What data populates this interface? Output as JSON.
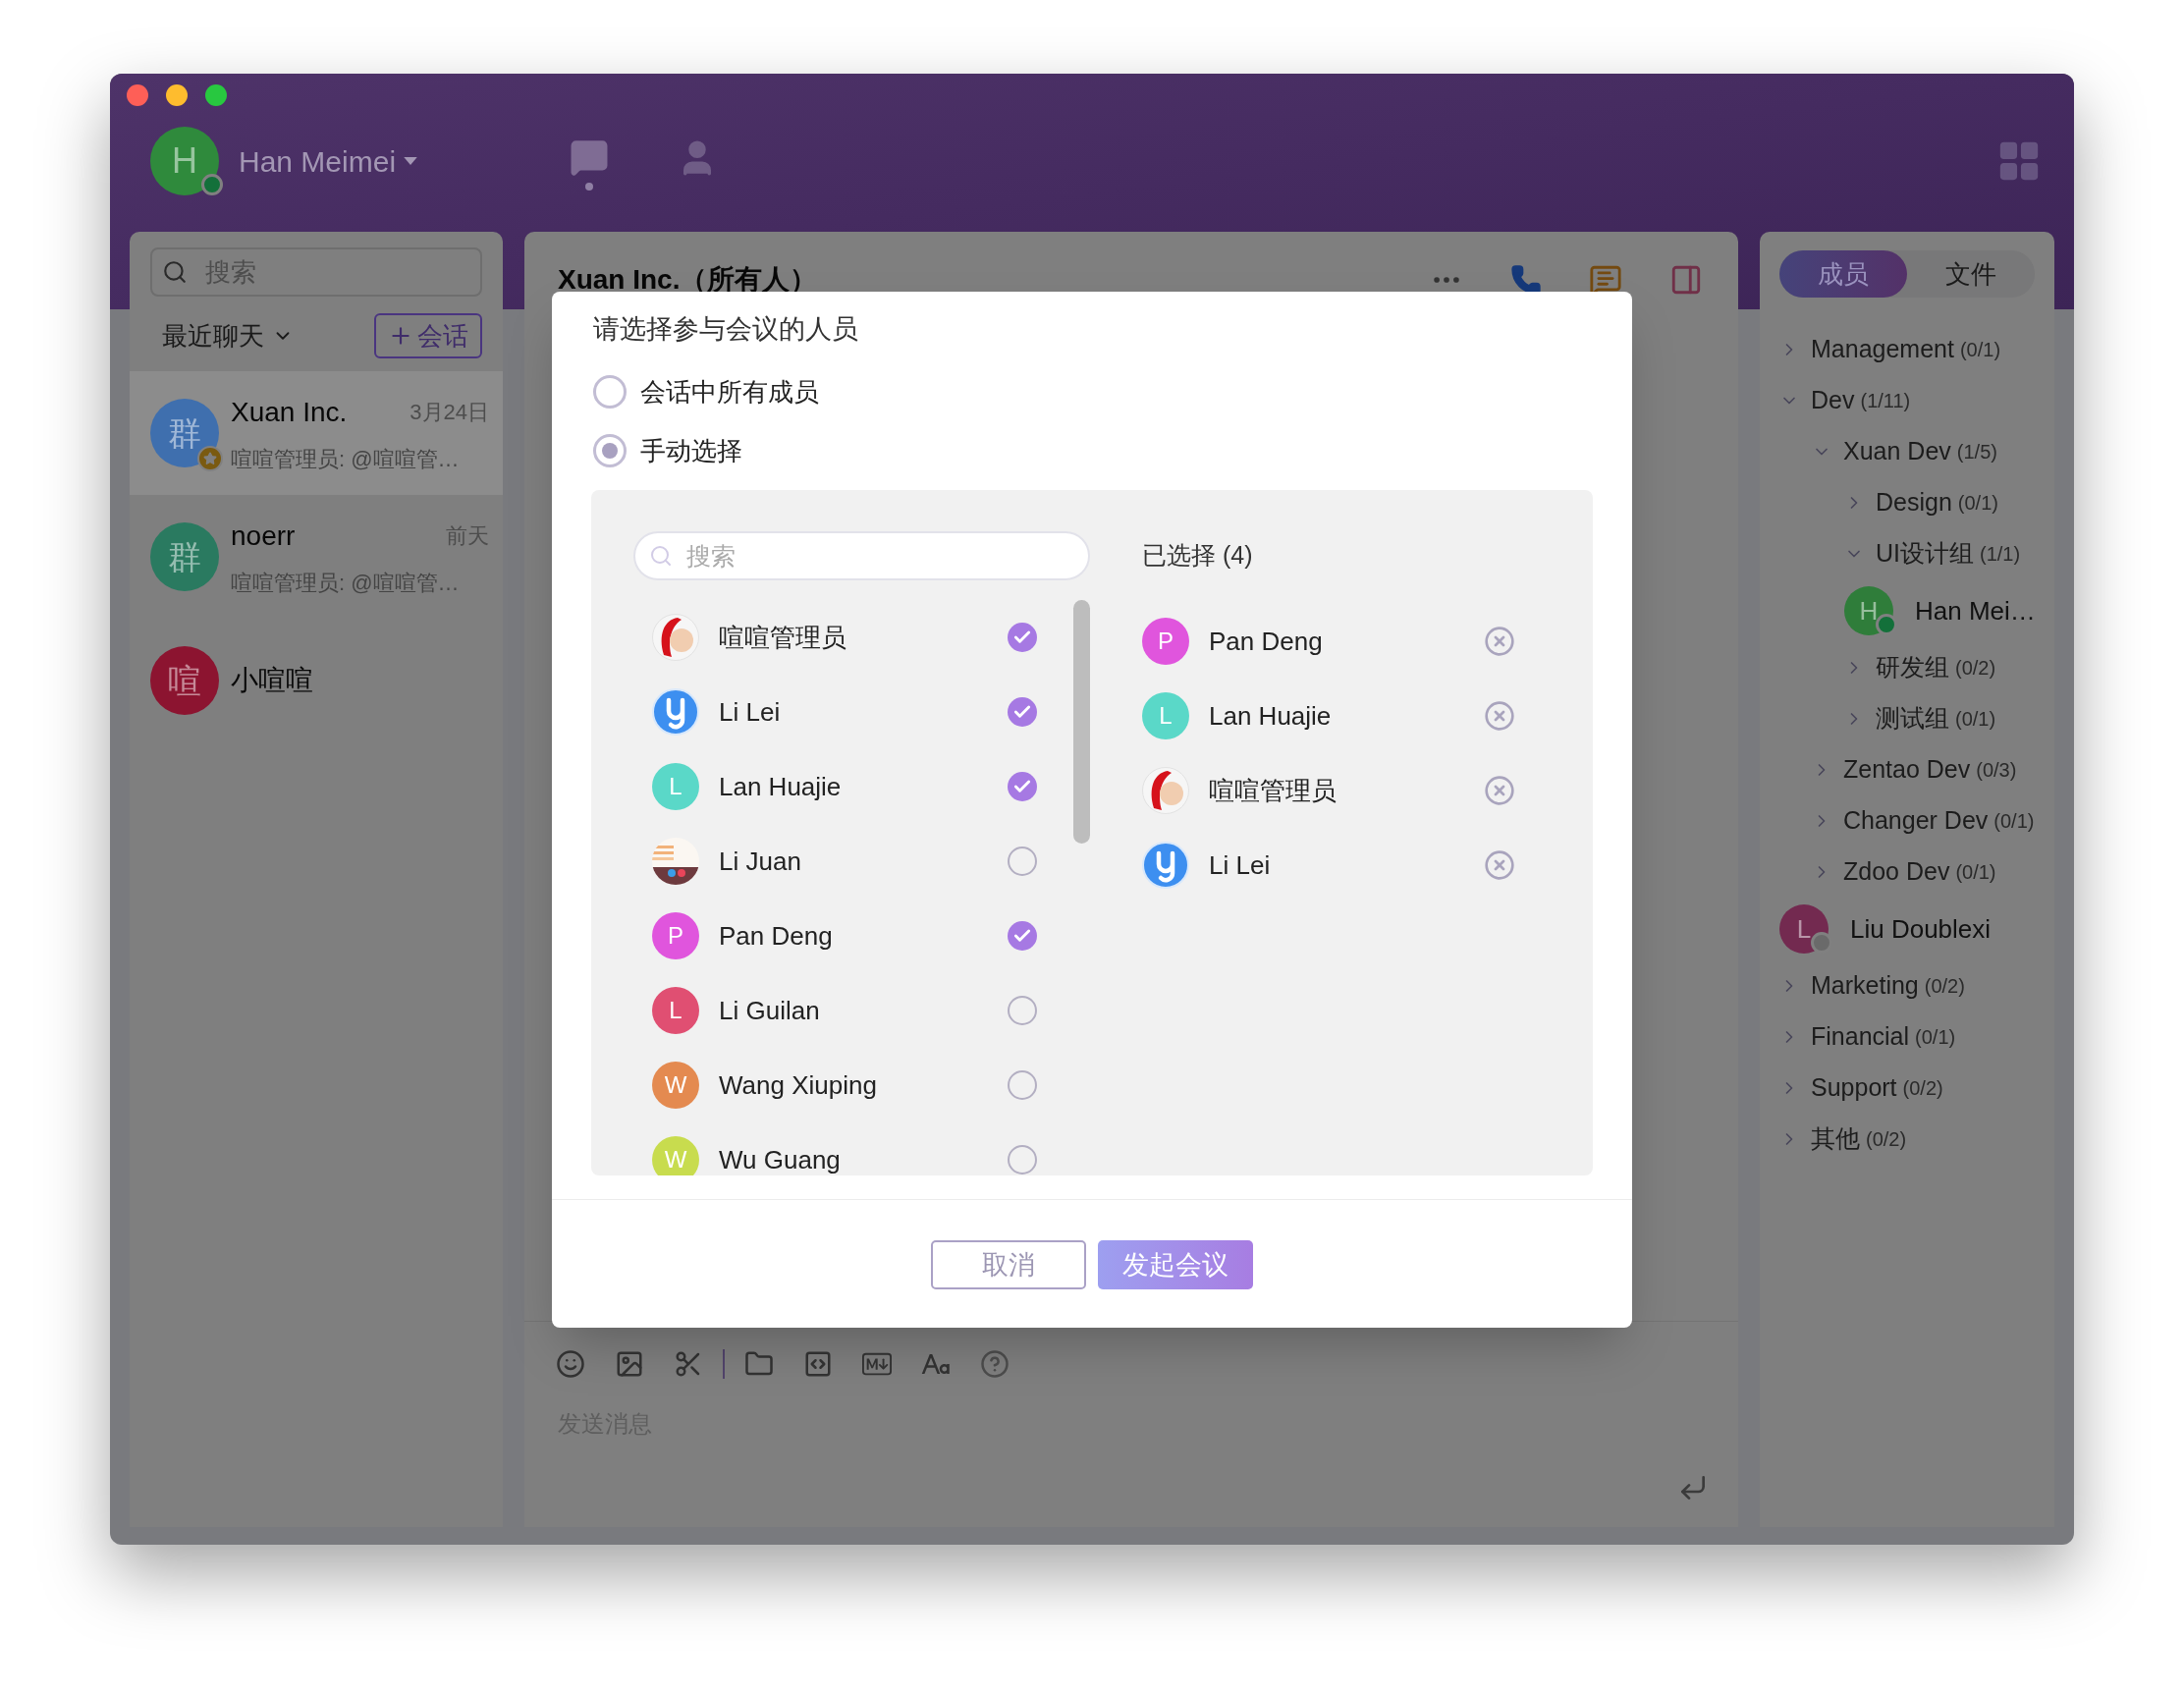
{
  "header": {
    "user": {
      "name": "Han Meimei",
      "avatar": {
        "kind": "letter",
        "initial": "H",
        "color": "#2f8a3c"
      },
      "online": true
    },
    "nav": [
      {
        "kind": "chat",
        "selected": true
      },
      {
        "kind": "contacts",
        "selected": false
      }
    ]
  },
  "sidebar": {
    "search": {
      "placeholder": "搜索"
    },
    "filter": "最近聊天",
    "new_chat_button": "会话",
    "chats": [
      {
        "name": "Xuan Inc.",
        "time": "3月24日",
        "preview": "喧喧管理员: @喧喧管…",
        "avatar": {
          "kind": "letter",
          "initial": "群",
          "color": "#3f6fae"
        },
        "starred": true,
        "selected": true
      },
      {
        "name": "noerr",
        "time": "前天",
        "preview": "喧喧管理员: @喧喧管…",
        "avatar": {
          "kind": "letter",
          "initial": "群",
          "color": "#2a7a60"
        },
        "starred": false,
        "selected": false
      },
      {
        "name": "小喧喧",
        "avatar": {
          "kind": "letter",
          "initial": "喧",
          "color": "#8c1430"
        },
        "starred": false,
        "selected": false
      }
    ]
  },
  "conversation": {
    "title": "Xuan Inc.（所有人）",
    "input_placeholder": "发送消息"
  },
  "members_panel": {
    "tabs": [
      {
        "label": "成员",
        "selected": true
      },
      {
        "label": "文件",
        "selected": false
      }
    ],
    "tree": [
      {
        "kind": "group",
        "label": "Management",
        "count": "(0/1)",
        "expanded": false
      },
      {
        "kind": "group",
        "label": "Dev",
        "count": "(1/11)",
        "expanded": true,
        "children": [
          {
            "kind": "group",
            "label": "Xuan Dev",
            "count": "(1/5)",
            "expanded": true,
            "children": [
              {
                "kind": "group",
                "label": "Design",
                "count": "(0/1)",
                "expanded": false
              },
              {
                "kind": "group",
                "label": "UI设计组",
                "count": "(1/1)",
                "expanded": true,
                "children": [
                  {
                    "kind": "member",
                    "name": "Han Mei…",
                    "avatar": {
                      "kind": "letter",
                      "initial": "H",
                      "color": "#2f7d3a"
                    },
                    "online": true
                  }
                ]
              },
              {
                "kind": "group",
                "label": "研发组",
                "count": "(0/2)",
                "expanded": false
              },
              {
                "kind": "group",
                "label": "测试组",
                "count": "(0/1)",
                "expanded": false
              }
            ]
          },
          {
            "kind": "group",
            "label": "Zentao Dev",
            "count": "(0/3)",
            "expanded": false
          },
          {
            "kind": "group",
            "label": "Changer Dev",
            "count": "(0/1)",
            "expanded": false
          },
          {
            "kind": "group",
            "label": "Zdoo Dev",
            "count": "(0/1)",
            "expanded": false
          },
          {
            "kind": "member",
            "name": "Liu Doublexi",
            "avatar": {
              "kind": "letter",
              "initial": "L",
              "color": "#732a50"
            },
            "online": false
          }
        ]
      },
      {
        "kind": "group",
        "label": "Marketing",
        "count": "(0/2)",
        "expanded": false
      },
      {
        "kind": "group",
        "label": "Financial",
        "count": "(0/1)",
        "expanded": false
      },
      {
        "kind": "group",
        "label": "Support",
        "count": "(0/2)",
        "expanded": false
      },
      {
        "kind": "group",
        "label": "其他",
        "count": "(0/2)",
        "expanded": false
      }
    ]
  },
  "dialog": {
    "title": "请选择参与会议的人员",
    "options": [
      {
        "label": "会话中所有成员",
        "selected": false
      },
      {
        "label": "手动选择",
        "selected": true
      }
    ],
    "search": {
      "placeholder": "搜索"
    },
    "people": [
      {
        "name": "喧喧管理员",
        "avatar": {
          "kind": "admin"
        },
        "checked": true
      },
      {
        "name": "Li Lei",
        "avatar": {
          "kind": "logo"
        },
        "checked": true
      },
      {
        "name": "Lan Huajie",
        "avatar": {
          "kind": "letter",
          "initial": "L",
          "color": "#5ad8c8"
        },
        "checked": true
      },
      {
        "name": "Li Juan",
        "checked": false
      },
      {
        "name": "Pan Deng",
        "avatar": {
          "kind": "letter",
          "initial": "P",
          "color": "#e055dd"
        },
        "checked": true
      },
      {
        "name": "Li Guilan",
        "avatar": {
          "kind": "letter",
          "initial": "L",
          "color": "#e04f72"
        },
        "checked": false
      },
      {
        "name": "Wang Xiuping",
        "avatar": {
          "kind": "letter",
          "initial": "W",
          "color": "#e48a50"
        },
        "checked": false
      },
      {
        "name": "Wu Guang",
        "avatar": {
          "kind": "letter",
          "initial": "W",
          "color": "#c8dc4e"
        },
        "checked": false
      }
    ],
    "selected_title": "已选择 (4)",
    "selected": [
      {
        "name": "Pan Deng",
        "avatar": {
          "kind": "letter",
          "initial": "P",
          "color": "#e055dd"
        }
      },
      {
        "name": "Lan Huajie",
        "avatar": {
          "kind": "letter",
          "initial": "L",
          "color": "#5ad8c8"
        }
      },
      {
        "name": "喧喧管理员",
        "avatar": {
          "kind": "admin"
        }
      },
      {
        "name": "Li Lei",
        "avatar": {
          "kind": "logo"
        }
      }
    ],
    "buttons": [
      {
        "label": "取消",
        "kind": "secondary"
      },
      {
        "label": "发起会议",
        "kind": "primary"
      }
    ]
  }
}
